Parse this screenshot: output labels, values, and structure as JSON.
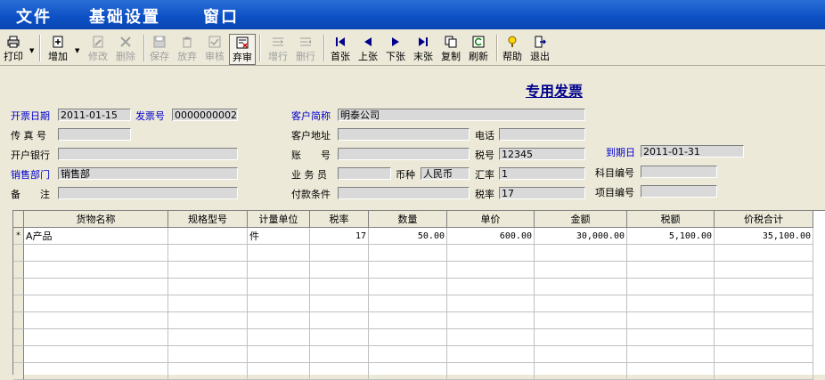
{
  "menu": [
    "文件",
    "基础设置",
    "窗口"
  ],
  "toolbar": [
    {
      "id": "print",
      "label": "打印",
      "icon": "printer-icon",
      "enabled": true,
      "dropdown": true
    },
    {
      "id": "add",
      "label": "增加",
      "icon": "add-doc-icon",
      "enabled": true,
      "dropdown": true
    },
    {
      "id": "edit",
      "label": "修改",
      "icon": "pencil-icon",
      "enabled": false
    },
    {
      "id": "delete",
      "label": "删除",
      "icon": "x-icon",
      "enabled": false
    },
    {
      "id": "save",
      "label": "保存",
      "icon": "disk-icon",
      "enabled": false
    },
    {
      "id": "discard",
      "label": "放弃",
      "icon": "trash-icon",
      "enabled": false
    },
    {
      "id": "review",
      "label": "审核",
      "icon": "check-doc-icon",
      "enabled": false
    },
    {
      "id": "unreview",
      "label": "弃审",
      "icon": "uncheck-doc-icon",
      "enabled": true,
      "active": true
    },
    {
      "id": "add_row",
      "label": "增行",
      "icon": "add-row-icon",
      "enabled": false
    },
    {
      "id": "del_row",
      "label": "删行",
      "icon": "del-row-icon",
      "enabled": false
    },
    {
      "id": "first",
      "label": "首张",
      "icon": "first-icon",
      "enabled": true
    },
    {
      "id": "prev",
      "label": "上张",
      "icon": "prev-icon",
      "enabled": true
    },
    {
      "id": "next",
      "label": "下张",
      "icon": "next-icon",
      "enabled": true
    },
    {
      "id": "last",
      "label": "末张",
      "icon": "last-icon",
      "enabled": true
    },
    {
      "id": "copy",
      "label": "复制",
      "icon": "copy-icon",
      "enabled": true
    },
    {
      "id": "refresh",
      "label": "刷新",
      "icon": "refresh-icon",
      "enabled": true
    },
    {
      "id": "help",
      "label": "帮助",
      "icon": "help-icon",
      "enabled": true
    },
    {
      "id": "exit",
      "label": "退出",
      "icon": "exit-icon",
      "enabled": true
    }
  ],
  "form": {
    "title": "专用发票",
    "fields": {
      "invoice_date": {
        "label": "开票日期",
        "value": "2011-01-15"
      },
      "invoice_no": {
        "label": "发票号",
        "value": "0000000002"
      },
      "customer_short": {
        "label": "客户简称",
        "value": "明泰公司"
      },
      "fax": {
        "label": "传 真 号",
        "value": ""
      },
      "customer_addr": {
        "label": "客户地址",
        "value": ""
      },
      "phone": {
        "label": "电话",
        "value": ""
      },
      "bank": {
        "label": "开户银行",
        "value": ""
      },
      "account": {
        "label": "账　　号",
        "value": ""
      },
      "tax_no": {
        "label": "税号",
        "value": "12345"
      },
      "due_date": {
        "label": "到期日",
        "value": "2011-01-31"
      },
      "sales_dept": {
        "label": "销售部门",
        "value": "销售部"
      },
      "salesperson": {
        "label": "业 务 员",
        "value": ""
      },
      "currency": {
        "label": "币种",
        "value": "人民币"
      },
      "rate": {
        "label": "汇率",
        "value": "1"
      },
      "subject_code": {
        "label": "科目编号",
        "value": ""
      },
      "remark": {
        "label": "备　　注",
        "value": ""
      },
      "payment_terms": {
        "label": "付款条件",
        "value": ""
      },
      "tax_rate": {
        "label": "税率",
        "value": "17"
      },
      "project_code": {
        "label": "项目编号",
        "value": ""
      }
    }
  },
  "grid": {
    "columns": [
      "货物名称",
      "规格型号",
      "计量单位",
      "税率",
      "数量",
      "单价",
      "金额",
      "税额",
      "价税合计"
    ],
    "rows": [
      {
        "marker": "*",
        "cells": [
          "A产品",
          "",
          "件",
          "17",
          "50.00",
          "600.00",
          "30,000.00",
          "5,100.00",
          "35,100.00"
        ]
      }
    ]
  }
}
